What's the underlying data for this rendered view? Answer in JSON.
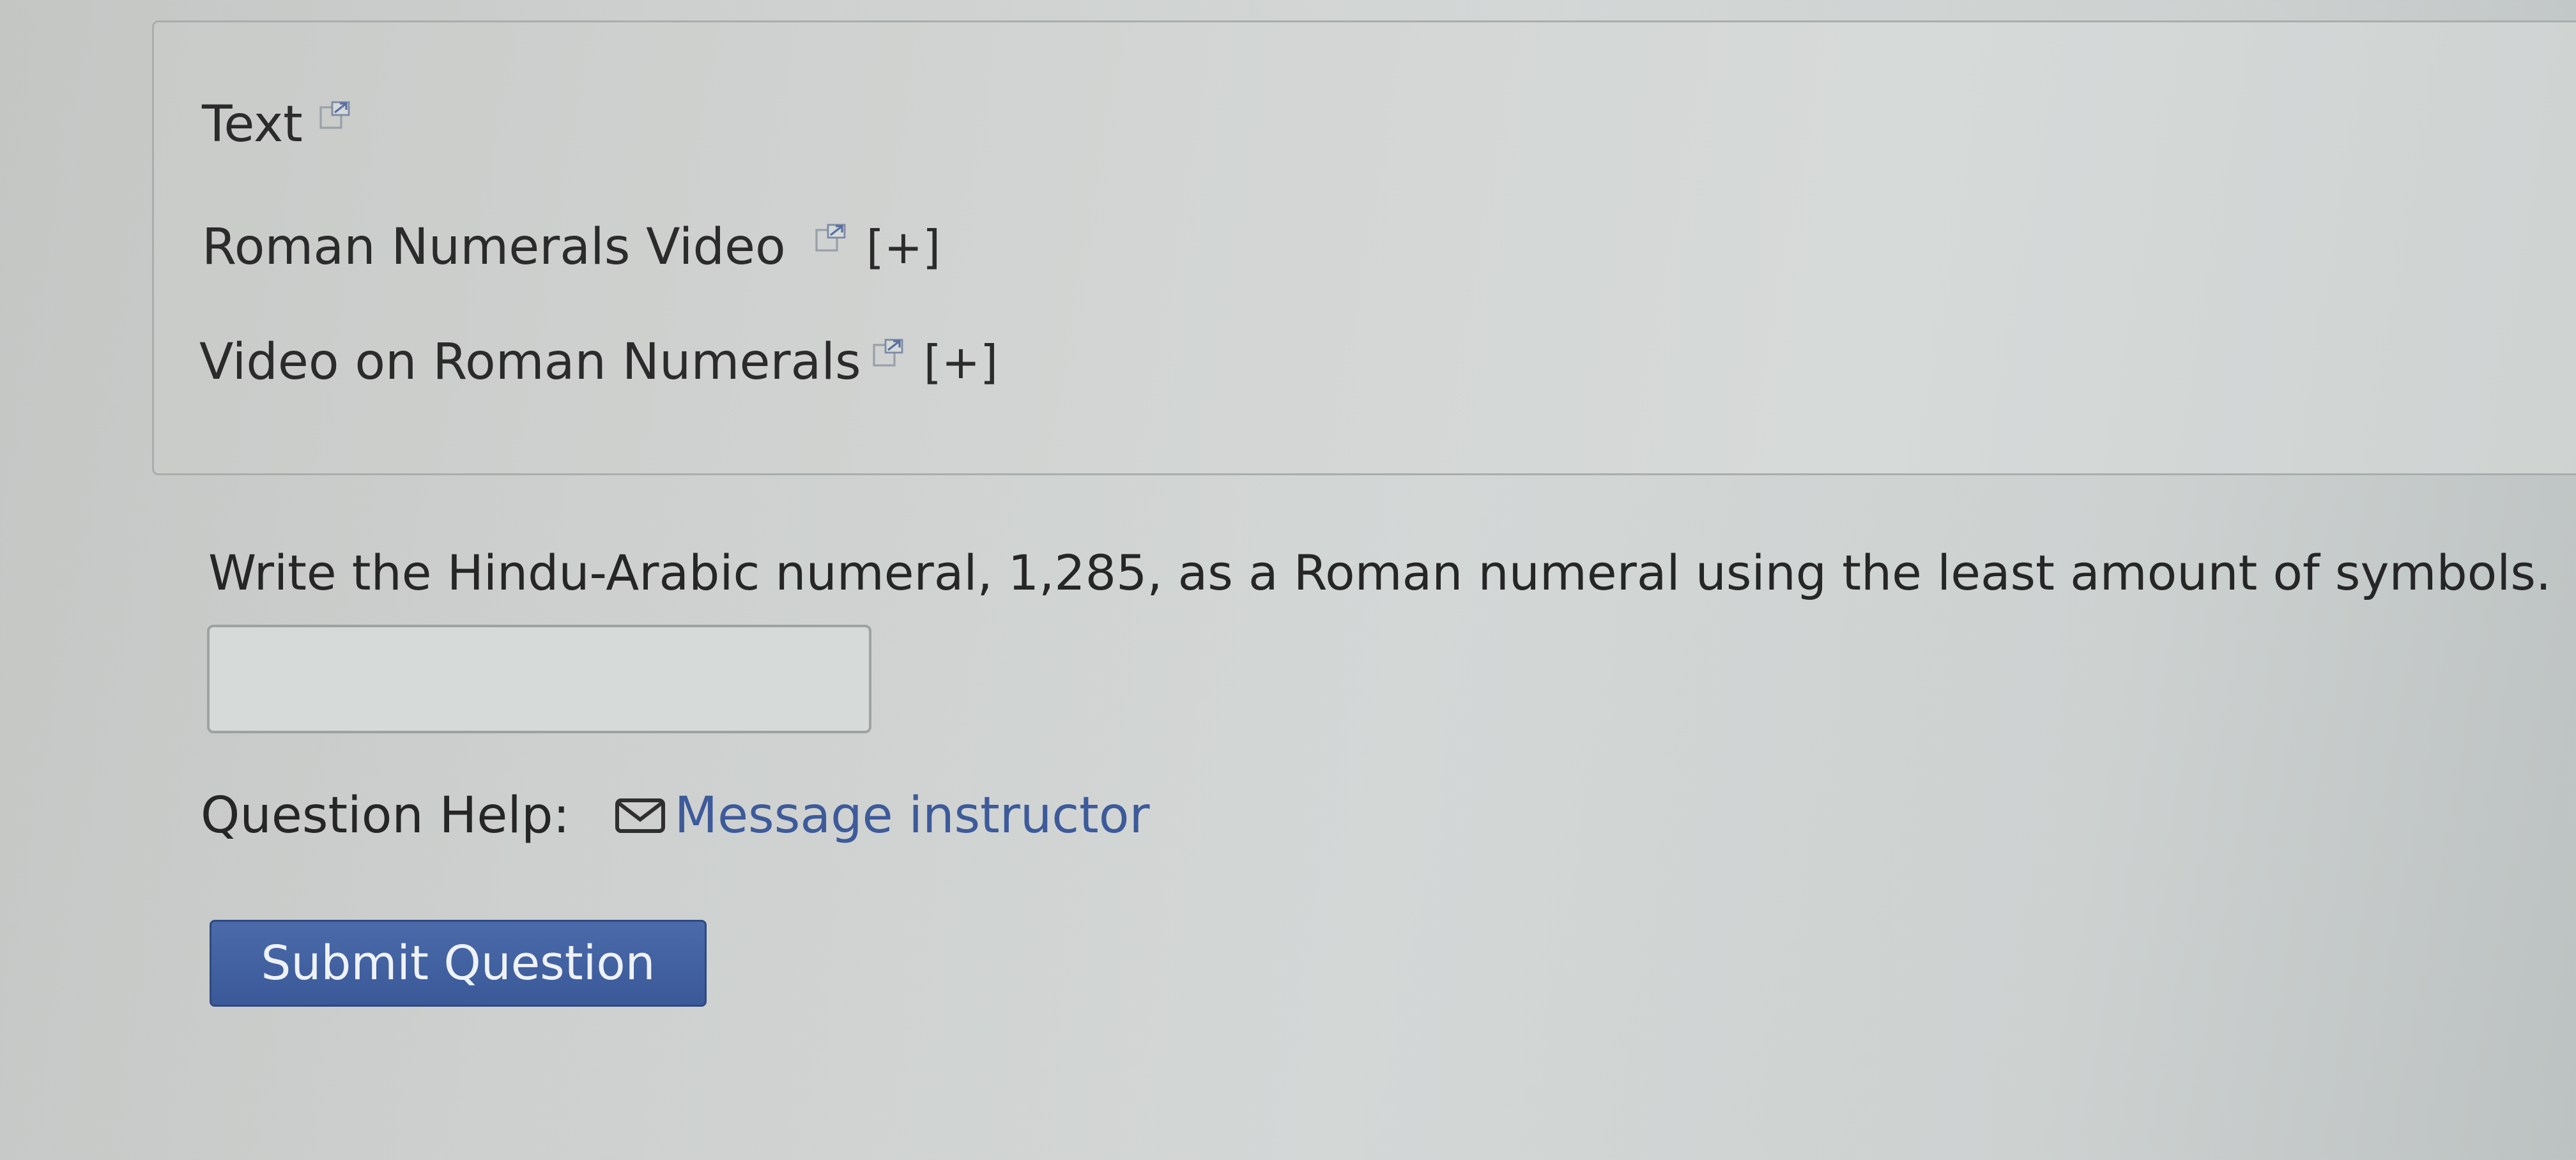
{
  "resources": [
    {
      "label": "Text",
      "external": true,
      "expand": ""
    },
    {
      "label": "Roman Numerals Video",
      "external": true,
      "expand": "[+]"
    },
    {
      "label": "Video on Roman Numerals",
      "external": true,
      "expand": "[+]"
    }
  ],
  "question": {
    "prompt": "Write the Hindu-Arabic numeral, 1,285, as a Roman numeral using the least amount of symbols.",
    "answer_value": "",
    "answer_placeholder": ""
  },
  "help": {
    "label": "Question Help:",
    "link_label": "Message instructor",
    "link_icon": "mail-icon"
  },
  "submit": {
    "label": "Submit Question",
    "color": "#3b5998"
  }
}
